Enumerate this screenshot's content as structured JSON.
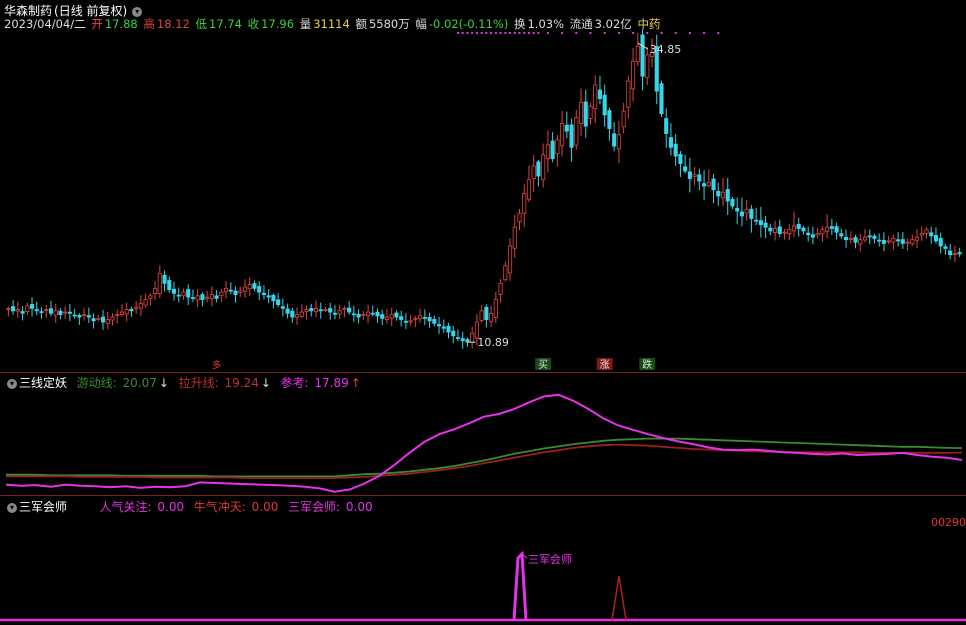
{
  "colors": {
    "up": "#e0443f",
    "down": "#38d4e8",
    "grid": "#7a1e1e",
    "green_line": "#3c8a2e",
    "red_line": "#9a2020",
    "magenta": "#e832e8",
    "dots": "#d040d8"
  },
  "header": {
    "name": "华森制药",
    "period": "(日线 前复权)",
    "date": "2023/04/04/二",
    "open_label": "开",
    "open": "17.88",
    "high_label": "高",
    "high": "18.12",
    "low_label": "低",
    "low": "17.74",
    "close_label": "收",
    "close": "17.96",
    "vol_label": "量",
    "vol": "31114",
    "amt_label": "额",
    "amt": "5580万",
    "chg_label": "幅",
    "chg": "-0.02(-0.11%)",
    "turn_label": "换",
    "turn": "1.03%",
    "float_label": "流通",
    "float": "3.02亿",
    "sector": "中药"
  },
  "indicator1": {
    "name": "三线定妖",
    "l1_label": "游动线:",
    "l1_value": "20.07",
    "l2_label": "拉升线:",
    "l2_value": "19.24",
    "l3_label": "参考:",
    "l3_value": "17.89"
  },
  "indicator2": {
    "name": "三军会师",
    "l1_label": "人气关注:",
    "l1_value": "0.00",
    "l2_label": "牛气冲天:",
    "l2_value": "0.00",
    "l3_label": "三军会师:",
    "l3_value": "0.00",
    "right_value": "00290"
  },
  "chart_data": {
    "type": "candlestick",
    "high_label": "34.85",
    "low_label": "10.89",
    "markers": {
      "buy": "买",
      "rise": "涨",
      "fall": "跌",
      "early": "多"
    },
    "peak_annotation": "三军会师",
    "price_range": [
      9.3,
      35.9
    ],
    "closes": [
      13.6,
      13.4,
      13.5,
      13.2,
      13.8,
      13.6,
      13.4,
      13.3,
      13.5,
      13.2,
      13.4,
      13.1,
      13.3,
      13.2,
      13.0,
      12.9,
      13.1,
      12.9,
      12.6,
      12.8,
      12.5,
      12.7,
      12.9,
      13.1,
      13.3,
      13.5,
      13.4,
      13.7,
      14.0,
      14.3,
      14.6,
      15.2,
      16.4,
      15.6,
      15.1,
      14.8,
      14.6,
      14.9,
      14.5,
      14.4,
      14.6,
      14.3,
      14.5,
      14.7,
      14.4,
      14.9,
      15.2,
      15.0,
      14.7,
      15.0,
      15.3,
      15.5,
      15.2,
      14.9,
      14.7,
      14.5,
      14.2,
      13.9,
      13.6,
      13.2,
      12.9,
      13.1,
      13.3,
      13.5,
      13.4,
      13.6,
      13.4,
      13.5,
      13.3,
      13.2,
      13.4,
      13.6,
      13.3,
      13.1,
      12.9,
      13.1,
      13.3,
      13.2,
      13.0,
      12.8,
      12.9,
      13.1,
      12.9,
      12.7,
      12.5,
      12.6,
      12.8,
      13.0,
      12.8,
      12.6,
      12.4,
      12.2,
      12.0,
      11.7,
      11.4,
      11.2,
      11.0,
      10.9,
      11.6,
      12.5,
      13.4,
      12.7,
      13.2,
      14.3,
      15.6,
      17.0,
      18.6,
      20.1,
      21.2,
      22.8,
      23.9,
      25.0,
      24.2,
      25.9,
      26.7,
      25.6,
      27.1,
      28.4,
      27.8,
      26.5,
      28.9,
      30.1,
      28.2,
      29.8,
      31.5,
      30.4,
      29.1,
      28.0,
      26.6,
      27.5,
      29.4,
      31.8,
      33.4,
      34.6,
      32.2,
      33.9,
      34.1,
      31.0,
      29.2,
      27.6,
      26.5,
      25.8,
      25.2,
      24.6,
      24.0,
      24.3,
      23.8,
      23.4,
      23.7,
      23.1,
      22.6,
      22.9,
      22.2,
      21.8,
      21.4,
      21.0,
      21.5,
      20.8,
      20.6,
      20.3,
      20.1,
      19.8,
      20.0,
      19.6,
      19.7,
      19.9,
      20.2,
      20.0,
      19.8,
      19.5,
      19.3,
      19.6,
      19.9,
      20.1,
      20.0,
      19.7,
      19.4,
      19.1,
      19.2,
      18.9,
      19.1,
      19.3,
      19.4,
      19.2,
      19.0,
      18.8,
      19.0,
      19.2,
      19.0,
      18.8,
      18.9,
      19.1,
      19.3,
      19.6,
      19.9,
      19.4,
      19.0,
      18.6,
      18.4,
      17.9,
      18.0,
      17.96
    ],
    "line_youdong": [
      15.2,
      15.2,
      15.2,
      15.1,
      15.1,
      15.1,
      15.1,
      15.1,
      15.0,
      15.0,
      15.0,
      15.0,
      15.0,
      15.0,
      14.9,
      14.9,
      14.9,
      14.9,
      14.9,
      14.9,
      14.9,
      14.9,
      14.9,
      15.1,
      15.3,
      15.4,
      15.6,
      15.8,
      16.1,
      16.4,
      16.8,
      17.3,
      17.8,
      18.4,
      19.0,
      19.5,
      20.0,
      20.4,
      20.8,
      21.1,
      21.4,
      21.6,
      21.7,
      21.8,
      21.8,
      21.8,
      21.7,
      21.6,
      21.5,
      21.4,
      21.3,
      21.2,
      21.1,
      21.0,
      20.9,
      20.8,
      20.7,
      20.6,
      20.5,
      20.4,
      20.3,
      20.3,
      20.2,
      20.1,
      20.07
    ],
    "line_lasheng": [
      14.9,
      14.9,
      14.9,
      14.9,
      14.9,
      14.8,
      14.8,
      14.8,
      14.8,
      14.8,
      14.7,
      14.7,
      14.7,
      14.7,
      14.7,
      14.7,
      14.6,
      14.6,
      14.6,
      14.6,
      14.6,
      14.6,
      14.6,
      14.7,
      14.8,
      15.0,
      15.2,
      15.4,
      15.7,
      16.0,
      16.4,
      16.8,
      17.3,
      17.8,
      18.3,
      18.8,
      19.3,
      19.7,
      20.1,
      20.4,
      20.6,
      20.7,
      20.6,
      20.5,
      20.3,
      20.1,
      19.9,
      19.8,
      19.7,
      19.6,
      19.5,
      19.4,
      19.4,
      19.3,
      19.3,
      19.3,
      19.3,
      19.3,
      19.2,
      19.2,
      19.2,
      19.2,
      19.2,
      19.2,
      19.24
    ],
    "line_cankao": [
      13.4,
      13.2,
      13.3,
      13.0,
      13.4,
      13.2,
      13.1,
      12.9,
      13.1,
      12.8,
      13.0,
      12.9,
      13.1,
      13.8,
      13.7,
      13.6,
      13.5,
      13.4,
      13.3,
      13.2,
      13.0,
      12.7,
      12.1,
      12.5,
      13.6,
      15.0,
      17.0,
      19.2,
      21.2,
      22.6,
      23.5,
      24.6,
      25.8,
      26.3,
      27.2,
      28.4,
      29.5,
      29.8,
      28.7,
      27.2,
      25.5,
      24.2,
      23.4,
      22.6,
      21.9,
      21.3,
      20.8,
      20.2,
      19.8,
      19.7,
      19.8,
      19.6,
      19.3,
      19.2,
      19.0,
      18.9,
      19.1,
      18.8,
      18.9,
      19.0,
      19.2,
      18.8,
      18.5,
      18.3,
      17.89
    ]
  }
}
